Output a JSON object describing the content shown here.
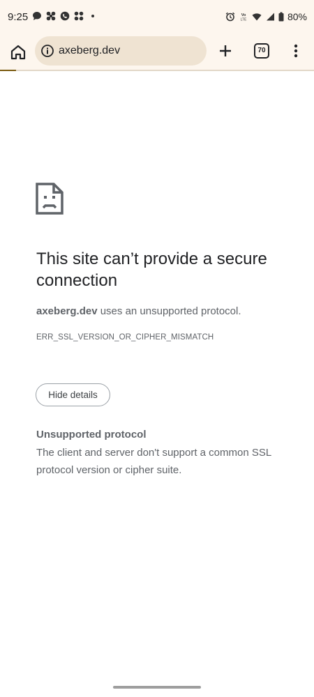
{
  "status_bar": {
    "time": "9:25",
    "left_icons": [
      "chat-bubble-icon",
      "app-icon",
      "call-icon",
      "app-icon",
      "dot-icon"
    ],
    "right_icons": [
      "alarm-icon",
      "volte-icon",
      "wifi-icon",
      "signal-icon",
      "battery-icon"
    ],
    "volte_label": "Vo LTE",
    "battery": "80%"
  },
  "toolbar": {
    "url": "axeberg.dev",
    "tab_count": "70",
    "page_load_progress": 0.05
  },
  "error_page": {
    "title": "This site can’t provide a secure connection",
    "description_host": "axeberg.dev",
    "description_rest": " uses an unsupported protocol.",
    "error_code": "ERR_SSL_VERSION_OR_CIPHER_MISMATCH",
    "hide_details_label": "Hide details",
    "details_heading": "Unsupported protocol",
    "details_body": "The client and server don't support a common SSL protocol version or cipher suite."
  },
  "colors": {
    "chrome_bar": "#fdf6ee",
    "omnibox": "#efe3d2",
    "progress": "#7a5a10"
  }
}
